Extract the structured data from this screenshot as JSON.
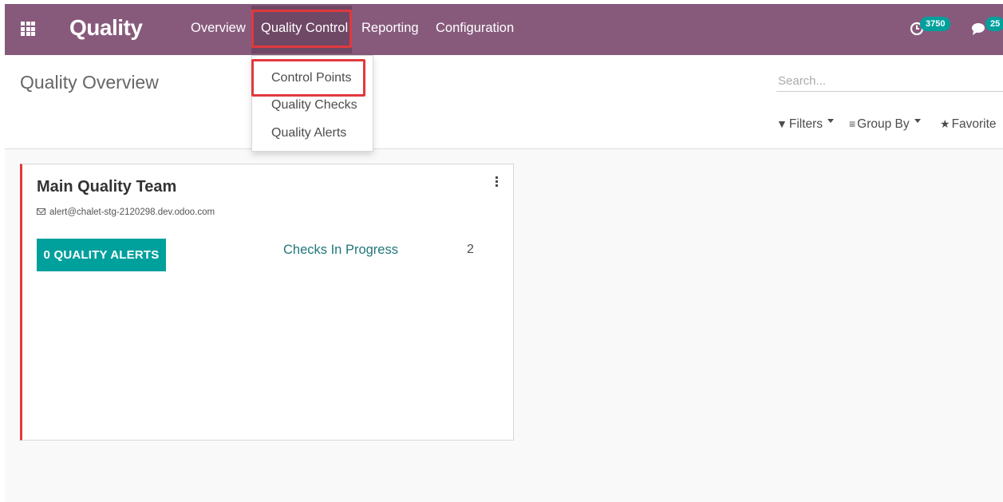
{
  "navbar": {
    "app_title": "Quality",
    "menus": {
      "overview": "Overview",
      "quality_control": "Quality Control",
      "reporting": "Reporting",
      "configuration": "Configuration"
    },
    "activities_badge": "3750",
    "messages_badge": "25",
    "color": "#875a7b"
  },
  "dropdown": {
    "items": [
      "Control Points",
      "Quality Checks",
      "Quality Alerts"
    ]
  },
  "control_panel": {
    "breadcrumb": "Quality Overview",
    "search_placeholder": "Search...",
    "filters_label": "Filters",
    "groupby_label": "Group By",
    "favorites_label": "Favorite"
  },
  "card": {
    "title": "Main Quality Team",
    "email": "alert@chalet-stg-2120298.dev.odoo.com",
    "alerts_button": "0 QUALITY ALERTS",
    "checks_label": "Checks In Progress",
    "checks_count": "2",
    "accent_color": "#00a09d",
    "stripe_color": "#e0393e"
  }
}
